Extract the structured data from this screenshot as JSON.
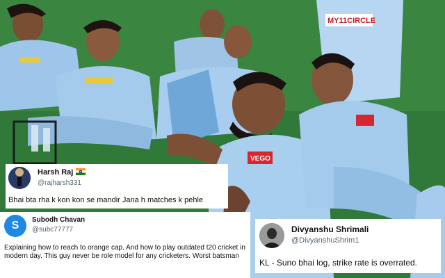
{
  "background": {
    "jersey_text_1": "MY11CIRCLE",
    "jersey_text_2": "VEGO",
    "colors": {
      "grass": "#2f7a38",
      "jersey": "#9ec6ea",
      "skin": "#8a5a3c"
    }
  },
  "tweets": [
    {
      "name": "Harsh Raj",
      "flag": "india-flag-icon",
      "handle": "@rajharsh331",
      "text": "Bhai bta rha k kon kon se mandir Jana h matches k pehle"
    },
    {
      "name": "Subodh Chavan",
      "avatar_letter": "S",
      "handle": "@subc77777",
      "text": "Explaining how to reach to orange cap. And how to play outdated t20 cricket in modern day. This guy never be role model for any cricketers. Worst batsman"
    },
    {
      "name": "Divyanshu Shrimali",
      "handle": "@DivyanshuShrim1",
      "text": "KL - Suno bhai log, strike rate is overrated."
    }
  ]
}
